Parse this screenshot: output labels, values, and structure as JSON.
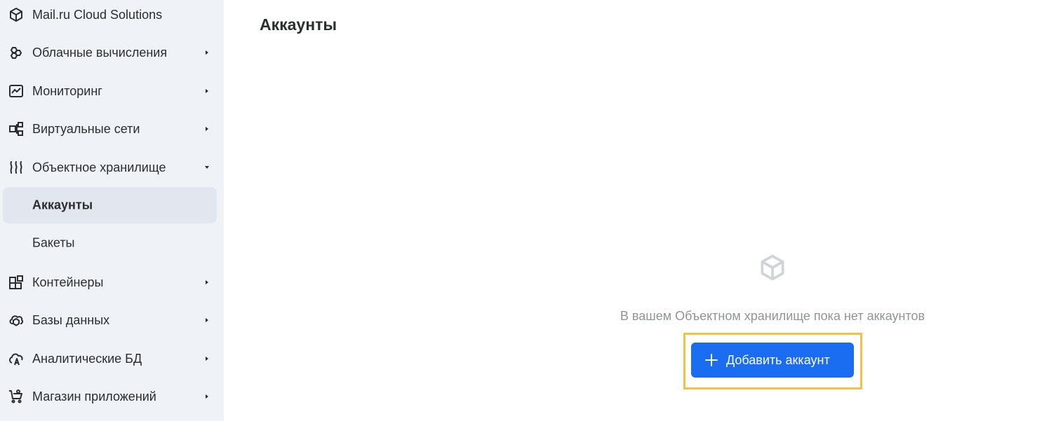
{
  "sidebar": {
    "items": [
      {
        "label": "Mail.ru Cloud Solutions",
        "icon": "cube-icon",
        "arrow": ""
      },
      {
        "label": "Облачные вычисления",
        "icon": "cloud-compute-icon",
        "arrow": "right"
      },
      {
        "label": "Мониторинг",
        "icon": "monitoring-chart-icon",
        "arrow": "right"
      },
      {
        "label": "Виртуальные сети",
        "icon": "network-icon",
        "arrow": "right"
      },
      {
        "label": "Объектное хранилище",
        "icon": "object-storage-icon",
        "arrow": "down"
      },
      {
        "label": "Контейнеры",
        "icon": "containers-icon",
        "arrow": "right"
      },
      {
        "label": "Базы данных",
        "icon": "database-icon",
        "arrow": "right"
      },
      {
        "label": "Аналитические БД",
        "icon": "analytics-db-icon",
        "arrow": "right"
      },
      {
        "label": "Магазин приложений",
        "icon": "app-store-cart-icon",
        "arrow": "right"
      }
    ],
    "subitems": [
      {
        "label": "Аккаунты",
        "active": true
      },
      {
        "label": "Бакеты",
        "active": false
      }
    ]
  },
  "main": {
    "title": "Аккаунты",
    "empty_state": {
      "icon": "cube-icon",
      "message": "В вашем Объектном хранилище пока нет аккаунтов",
      "button_label": "Добавить аккаунт"
    }
  },
  "colors": {
    "sidebar_bg": "#eff2f7",
    "active_item_bg": "#e1e6ef",
    "primary_button": "#1a6cf0",
    "highlight_border": "#f4c04a",
    "muted_text": "#919399"
  }
}
